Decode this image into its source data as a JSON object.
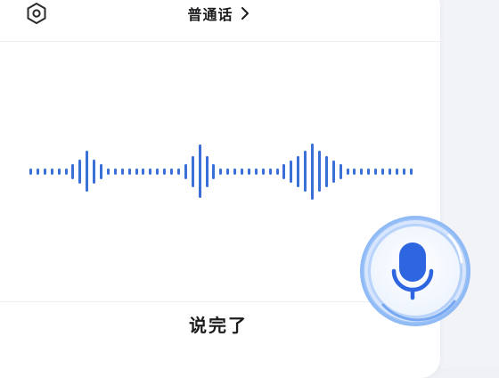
{
  "header": {
    "language_label": "普通话",
    "chevron": "›",
    "settings_icon": "hexagon-settings-icon"
  },
  "waveform": {
    "color": "#3a6fd8",
    "levels": [
      0.08,
      0.08,
      0.08,
      0.08,
      0.08,
      0.08,
      0.2,
      0.32,
      0.55,
      0.32,
      0.2,
      0.08,
      0.08,
      0.08,
      0.08,
      0.08,
      0.08,
      0.08,
      0.08,
      0.08,
      0.08,
      0.08,
      0.2,
      0.42,
      0.72,
      0.42,
      0.2,
      0.08,
      0.08,
      0.08,
      0.08,
      0.08,
      0.08,
      0.08,
      0.08,
      0.08,
      0.2,
      0.3,
      0.42,
      0.55,
      0.75,
      0.55,
      0.42,
      0.3,
      0.2,
      0.08,
      0.08,
      0.08,
      0.08,
      0.08,
      0.08,
      0.08,
      0.08,
      0.08,
      0.08
    ]
  },
  "footer": {
    "done_label": "说完了"
  },
  "mic": {
    "icon": "microphone-icon",
    "accent": "#2d66e0"
  },
  "colors": {
    "panel_bg": "#ffffff",
    "page_bg": "#eef0f4",
    "text": "#1c1c1e"
  }
}
